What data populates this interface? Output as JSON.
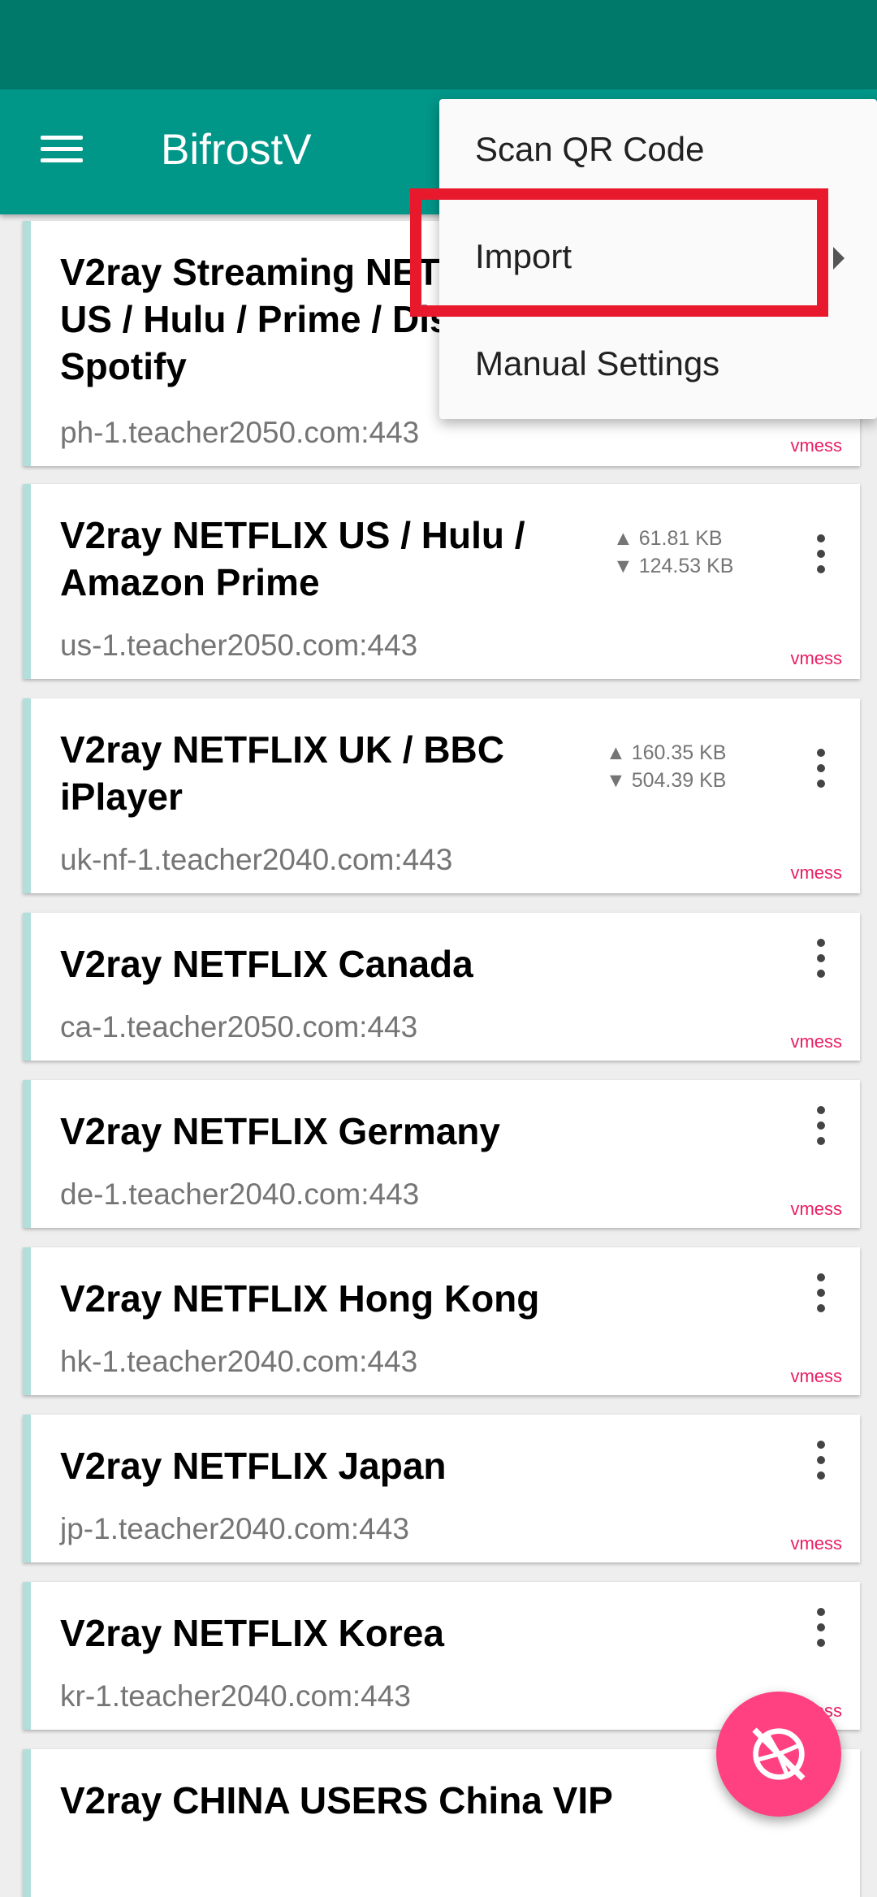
{
  "app": {
    "title": "BifrostV"
  },
  "menu": {
    "items": [
      {
        "label": "Scan QR Code"
      },
      {
        "label": "Import"
      },
      {
        "label": "Manual Settings"
      }
    ]
  },
  "servers": [
    {
      "name": "V2ray Streaming NETFLIX US / Hulu / Prime / Disney / Spotify",
      "address": "ph-1.teacher2050.com:443",
      "type": "vmess"
    },
    {
      "name": "V2ray NETFLIX US / Hulu / Amazon Prime",
      "address": "us-1.teacher2050.com:443",
      "type": "vmess",
      "upload": "▲ 61.81 KB",
      "download": "▼ 124.53 KB"
    },
    {
      "name": "V2ray NETFLIX UK / BBC iPlayer",
      "address": "uk-nf-1.teacher2040.com:443",
      "type": "vmess",
      "upload": "▲ 160.35 KB",
      "download": "▼ 504.39 KB"
    },
    {
      "name": "V2ray NETFLIX Canada",
      "address": "ca-1.teacher2050.com:443",
      "type": "vmess"
    },
    {
      "name": "V2ray NETFLIX Germany",
      "address": "de-1.teacher2040.com:443",
      "type": "vmess"
    },
    {
      "name": "V2ray NETFLIX Hong Kong",
      "address": "hk-1.teacher2040.com:443",
      "type": "vmess"
    },
    {
      "name": "V2ray NETFLIX Japan",
      "address": "jp-1.teacher2040.com:443",
      "type": "vmess"
    },
    {
      "name": "V2ray NETFLIX Korea",
      "address": "kr-1.teacher2040.com:443",
      "type": "vmess"
    },
    {
      "name": "V2ray CHINA USERS China VIP",
      "address": "",
      "type": ""
    }
  ],
  "icons": {
    "menu": "hamburger-menu-icon",
    "more": "more-vert-icon",
    "fab": "shutter-off-icon"
  },
  "colors": {
    "primary": "#009688",
    "primary_dark": "#00796b",
    "accent": "#ff4081",
    "type_label": "#e91e63",
    "highlight": "#e8192c"
  }
}
